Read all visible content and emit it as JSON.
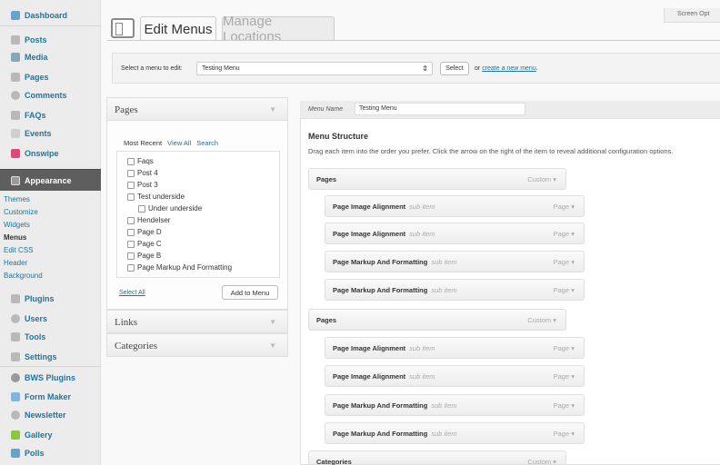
{
  "sidebar": {
    "items": [
      {
        "label": "Dashboard",
        "icon": "dashboard-icon",
        "color": "#6aa3c9"
      },
      {
        "label": "Posts",
        "icon": "pin-icon",
        "color": "#b9b9b9"
      },
      {
        "label": "Media",
        "icon": "media-icon",
        "color": "#8aa6b5"
      },
      {
        "label": "Pages",
        "icon": "pages-icon",
        "color": "#b9b9b9"
      },
      {
        "label": "Comments",
        "icon": "comments-icon",
        "color": "#b9b9b9"
      },
      {
        "label": "FAQs",
        "icon": "pin-icon",
        "color": "#b9b9b9"
      },
      {
        "label": "Events",
        "icon": "events-icon",
        "color": "#cfcfcf"
      },
      {
        "label": "Onswipe",
        "icon": "onswipe-icon",
        "color": "#e0457b"
      },
      {
        "label": "Appearance",
        "icon": "appearance-icon",
        "color": "#9a9a9a"
      },
      {
        "label": "Plugins",
        "icon": "plugins-icon",
        "color": "#b9b9b9"
      },
      {
        "label": "Users",
        "icon": "users-icon",
        "color": "#b9b9b9"
      },
      {
        "label": "Tools",
        "icon": "tools-icon",
        "color": "#b9b9b9"
      },
      {
        "label": "Settings",
        "icon": "settings-icon",
        "color": "#b9b9b9"
      },
      {
        "label": "BWS Plugins",
        "icon": "bws-icon",
        "color": "#999999"
      },
      {
        "label": "Form Maker",
        "icon": "form-maker-icon",
        "color": "#7fb6dd"
      },
      {
        "label": "Newsletter",
        "icon": "newsletter-icon",
        "color": "#b9b9b9"
      },
      {
        "label": "Gallery",
        "icon": "gallery-icon",
        "color": "#8cc63f"
      },
      {
        "label": "Polls",
        "icon": "polls-icon",
        "color": "#6aa3c9"
      }
    ],
    "appearance_sub": [
      "Themes",
      "Customize",
      "Widgets",
      "Menus",
      "Edit CSS",
      "Header",
      "Background"
    ]
  },
  "header": {
    "tab_edit": "Edit Menus",
    "tab_manage": "Manage Locations",
    "screen_options": "Screen Opt"
  },
  "select_bar": {
    "label": "Select a menu to edit:",
    "selected": "Testing Menu",
    "select_button": "Select",
    "or_text": "or",
    "create_link": "create a new menu",
    "create_link_period": "."
  },
  "left": {
    "pages_title": "Pages",
    "tabs": [
      "Most Recent",
      "View All",
      "Search"
    ],
    "pages": [
      "Faqs",
      "Post 4",
      "Post 3",
      "Test underside",
      "Under underside",
      "Hendelser",
      "Page D",
      "Page C",
      "Page B",
      "Page Markup And Formatting"
    ],
    "select_all": "Select All",
    "add_button": "Add to Menu",
    "links_title": "Links",
    "categories_title": "Categories"
  },
  "menu": {
    "name_label": "Menu Name",
    "name_value": "Testing Menu",
    "structure_title": "Menu Structure",
    "structure_desc": "Drag each item into the order you prefer. Click the arrow on the right of the item to reveal additional configuration options.",
    "sub_label": "sub item",
    "items": [
      {
        "title": "Pages",
        "type": "Custom"
      },
      {
        "title": "Page Image Alignment",
        "type": "Page"
      },
      {
        "title": "Page Image Alignment",
        "type": "Page"
      },
      {
        "title": "Page Markup And Formatting",
        "type": "Page"
      },
      {
        "title": "Page Markup And Formatting",
        "type": "Page"
      },
      {
        "title": "Pages",
        "type": "Custom"
      },
      {
        "title": "Page Image Alignment",
        "type": "Page"
      },
      {
        "title": "Page Image Alignment",
        "type": "Page"
      },
      {
        "title": "Page Markup And Formatting",
        "type": "Page"
      },
      {
        "title": "Page Markup And Formatting",
        "type": "Page"
      },
      {
        "title": "Categories",
        "type": "Custom"
      }
    ]
  }
}
